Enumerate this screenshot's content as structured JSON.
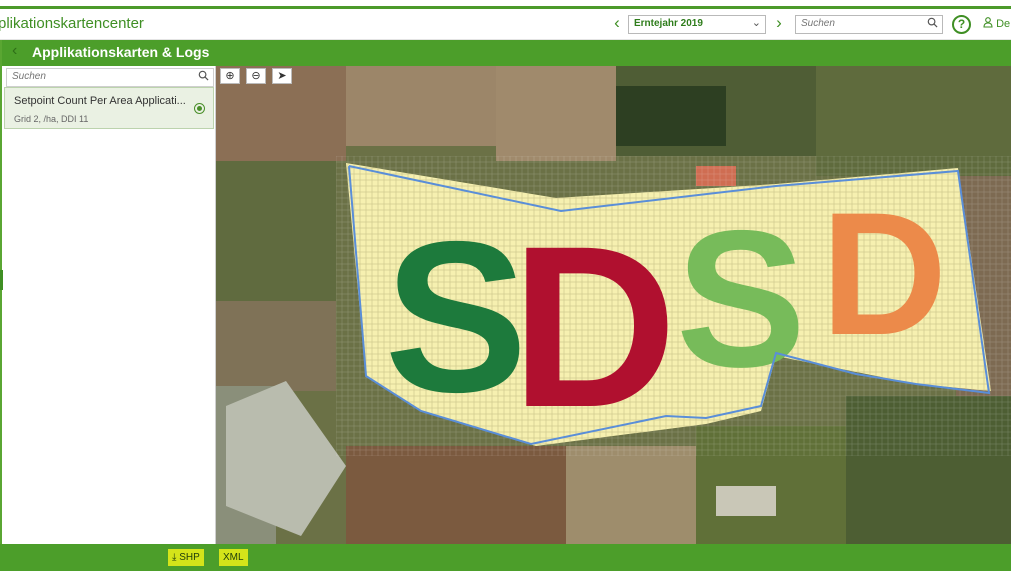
{
  "header": {
    "app_title": "plikationskartencenter",
    "year": "Erntejahr 2019",
    "search_placeholder": "Suchen",
    "help": "?",
    "user": "De"
  },
  "sidebar": {
    "title": "Applikationskarten & Logs",
    "search_placeholder": "Suchen",
    "items": [
      {
        "name": "Setpoint Count Per Area Applicati...",
        "sub": "Grid 2, /ha, DDI 11",
        "selected": true
      }
    ]
  },
  "map": {
    "letters": [
      "S",
      "D",
      "S",
      "D"
    ],
    "letter_colors": [
      "#1d7a3c",
      "#b0102f",
      "#77bb5a",
      "#ec8a4a"
    ],
    "grid_fill": "#f6f0b0",
    "boundary_color": "#5a8ed8"
  },
  "footer": {
    "shp_label": "SHP",
    "xml_label": "XML"
  },
  "colors": {
    "accent": "#4c9e2a",
    "button": "#d4e41a"
  }
}
